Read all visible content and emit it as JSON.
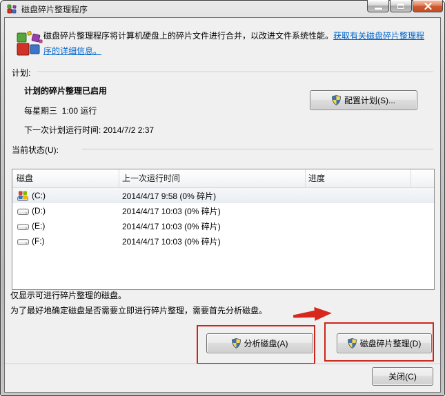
{
  "window": {
    "title": "磁盘碎片整理程序"
  },
  "header": {
    "description": "磁盘碎片整理程序将计算机硬盘上的碎片文件进行合并，以改进文件系统性能。",
    "link": "获取有关磁盘碎片整理程序的详细信息。"
  },
  "schedule": {
    "section_label": "计划:",
    "status": "计划的碎片整理已启用",
    "frequency": "每星期三  1:00 运行",
    "next_run": "下一次计划运行时间: 2014/7/2 2:37",
    "configure_button": "配置计划(S)..."
  },
  "current_status": {
    "section_label": "当前状态(U):",
    "table": {
      "columns": [
        "磁盘",
        "上一次运行时间",
        "进度"
      ],
      "rows": [
        {
          "disk": "(C:)",
          "last_run": "2014/4/17 9:58 (0% 碎片)",
          "progress": "",
          "selected": true
        },
        {
          "disk": "(D:)",
          "last_run": "2014/4/17 10:03 (0% 碎片)",
          "progress": "",
          "selected": false
        },
        {
          "disk": "(E:)",
          "last_run": "2014/4/17 10:03 (0% 碎片)",
          "progress": "",
          "selected": false
        },
        {
          "disk": "(F:)",
          "last_run": "2014/4/17 10:03 (0% 碎片)",
          "progress": "",
          "selected": false
        }
      ]
    }
  },
  "notes": {
    "line1": "仅显示可进行碎片整理的磁盘。",
    "line2": "为了最好地确定磁盘是否需要立即进行碎片整理，需要首先分析磁盘。"
  },
  "actions": {
    "analyze": "分析磁盘(A)",
    "defragment": "磁盘碎片整理(D)",
    "close": "关闭(C)"
  },
  "icons": {
    "app": "defrag-colored-blocks",
    "action_buttons": "uac-shield",
    "system_drive": "windows-system-drive",
    "data_drive": "hard-drive"
  },
  "colors": {
    "annotation_red": "#d6281c",
    "link_blue": "#0066cc",
    "dialog_bg": "#f0f0f0"
  }
}
